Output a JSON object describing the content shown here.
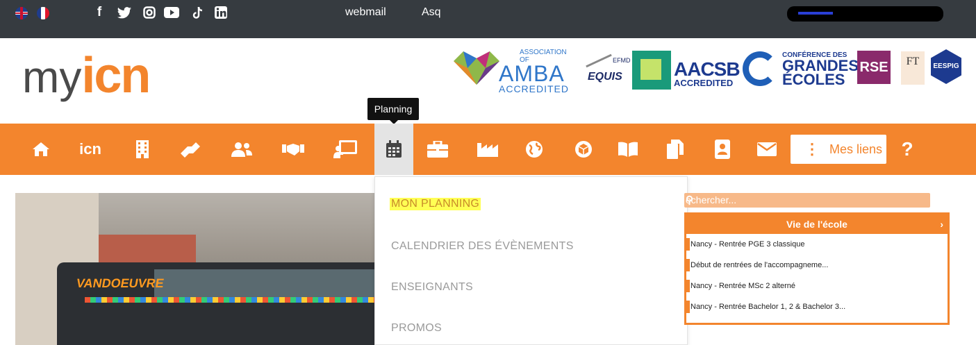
{
  "topbar": {
    "links": [
      "webmail",
      "Asq"
    ],
    "social_icons": [
      "facebook-icon",
      "twitter-icon",
      "instagram-icon",
      "youtube-icon",
      "tiktok-icon",
      "linkedin-icon"
    ],
    "languages": [
      "English",
      "Français"
    ]
  },
  "logo": {
    "my": "my",
    "icn": "icn"
  },
  "accreditations": {
    "amba_small": "ASSOCIATION OF",
    "amba_big": "AMBA",
    "amba_sub": "ACCREDITED",
    "equis_efmd": "EFMD",
    "equis": "EQUIS",
    "aacsb": "AACSB",
    "aacsb_sub": "ACCREDITED",
    "cge_small": "CONFÉRENCE DES",
    "cge_line1": "GRANDES",
    "cge_line2": "ÉCOLES",
    "rse": "RSE",
    "ft": "FT",
    "eespig": "EESPIG"
  },
  "tooltip": "Planning",
  "nav": {
    "icn_label": "icn",
    "mes_liens": "Mes liens",
    "help": "?",
    "accent_color": "#f3852d"
  },
  "dropdown": {
    "items": [
      "MON PLANNING",
      "CALENDRIER DES ÉVÈNEMENTS",
      "ENSEIGNANTS",
      "PROMOS"
    ]
  },
  "search": {
    "placeholder": "echercher..."
  },
  "vie_ecole": {
    "title": "Vie de l'école",
    "items": [
      "Nancy - Rentrée PGE 3 classique",
      "Début de rentrées de l'accompagneme...",
      "Nancy - Rentrée MSc 2 alterné",
      "Nancy - Rentrée Bachelor 1, 2 & Bachelor 3..."
    ]
  },
  "photo": {
    "destination": "VANDOEUVRE"
  }
}
